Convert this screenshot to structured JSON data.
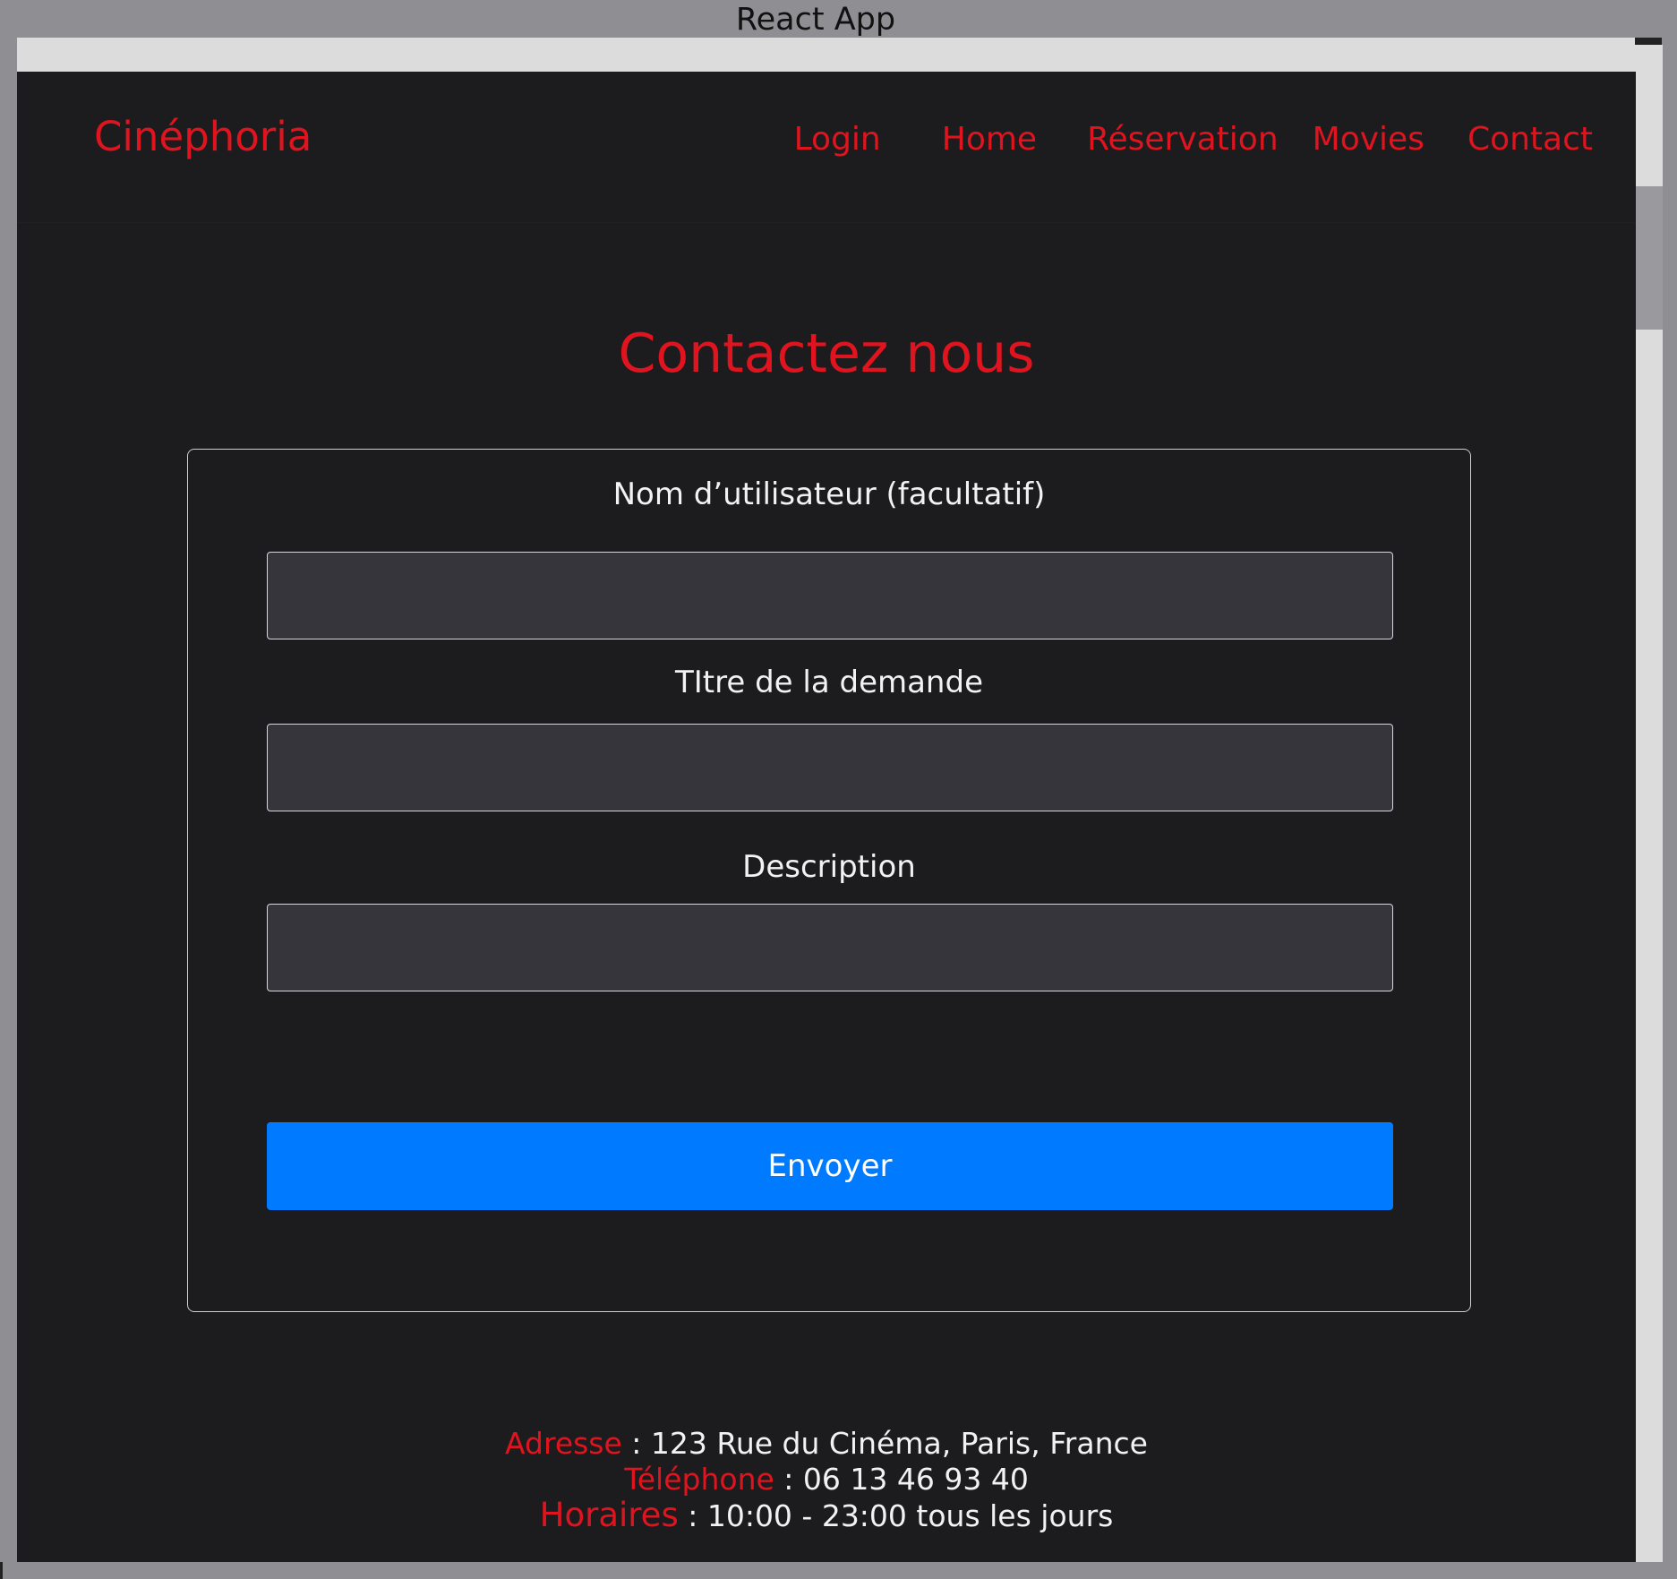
{
  "window": {
    "title": "React App"
  },
  "navbar": {
    "brand": "Cinéphoria",
    "links": [
      {
        "label": "Login"
      },
      {
        "label": "Home"
      },
      {
        "label": "Réservation"
      },
      {
        "label": "Movies"
      },
      {
        "label": "Contact"
      }
    ]
  },
  "page": {
    "heading": "Contactez nous"
  },
  "form": {
    "username": {
      "label": "Nom d’utilisateur (facultatif)",
      "value": ""
    },
    "title": {
      "label": "TItre de la demande",
      "value": ""
    },
    "description": {
      "label": "Description",
      "value": ""
    },
    "submit_label": "Envoyer"
  },
  "footer": {
    "address_label": "Adresse",
    "address_value": " : 123 Rue du Cinéma, Paris, France",
    "phone_label": "Téléphone",
    "phone_value": " : 06 13 46 93 40",
    "hours_label": "Horaires",
    "hours_value": " : 10:00 - 23:00 tous les jours"
  },
  "colors": {
    "accent": "#e0141e",
    "background": "#1c1c1e",
    "input_background": "#35353b",
    "button": "#007bff"
  }
}
